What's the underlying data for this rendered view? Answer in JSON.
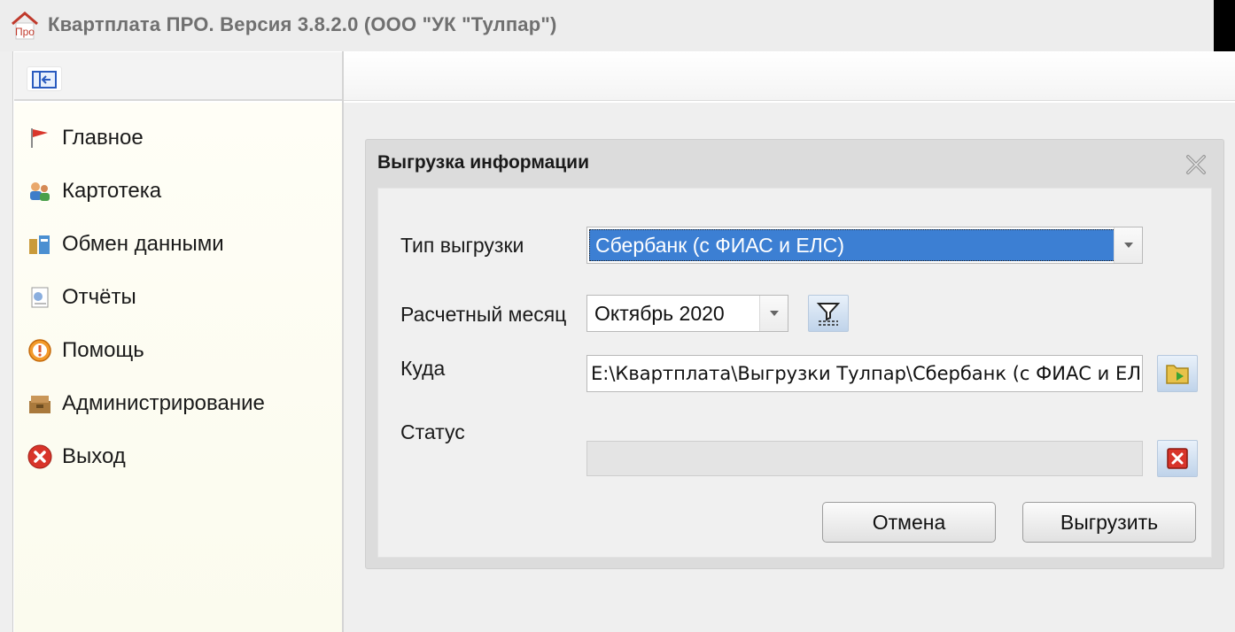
{
  "window": {
    "app_icon_text": "Про",
    "title": "Квартплата ПРО.  Версия 3.8.2.0 (ООО \"УК \"Тулпар\")"
  },
  "sidebar": {
    "items": [
      {
        "label": "Главное",
        "icon": "flag-icon"
      },
      {
        "label": "Картотека",
        "icon": "people-icon"
      },
      {
        "label": "Обмен данными",
        "icon": "exchange-icon"
      },
      {
        "label": "Отчёты",
        "icon": "reports-icon"
      },
      {
        "label": "Помощь",
        "icon": "help-icon"
      },
      {
        "label": "Администрирование",
        "icon": "admin-icon"
      },
      {
        "label": "Выход",
        "icon": "exit-icon"
      }
    ]
  },
  "dialog": {
    "title": "Выгрузка информации",
    "export_type_label": "Тип выгрузки",
    "export_type_value": "Сбербанк (с ФИАС и ЕЛС)",
    "month_label": "Расчетный месяц",
    "month_value": "Октябрь 2020",
    "destination_label": "Куда",
    "destination_value": "E:\\Квартплата\\Выгрузки Тулпар\\Сбербанк (с ФИАС и ЕЛС)",
    "status_label": "Статус",
    "cancel_label": "Отмена",
    "export_label": "Выгрузить"
  },
  "colors": {
    "selection": "#3c7fd3",
    "sidebar_bg": "#fffef6",
    "dialog_bg": "#f0f0f0"
  }
}
